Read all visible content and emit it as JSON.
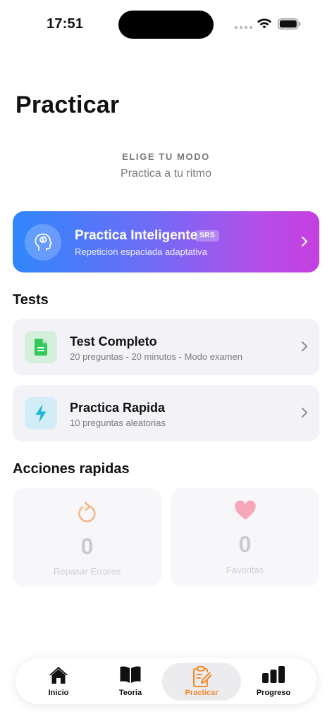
{
  "status_bar": {
    "time": "17:51"
  },
  "page": {
    "title": "Practicar",
    "mode_label": "ELIGE TU MODO",
    "mode_subtitle": "Practica a tu ritmo"
  },
  "smart_practice": {
    "title": "Practica Inteligente",
    "badge": "SRS",
    "subtitle": "Repeticion espaciada adaptativa",
    "icon": "brain-icon",
    "gradient": [
      "#2f86fb",
      "#c63fe0"
    ]
  },
  "tests": {
    "section_title": "Tests",
    "items": [
      {
        "title": "Test Completo",
        "subtitle": "20 preguntas - 20 minutos - Modo examen",
        "icon": "document-icon",
        "accent": "#34c759"
      },
      {
        "title": "Practica Rapida",
        "subtitle": "10 preguntas aleatorias",
        "icon": "bolt-icon",
        "accent": "#1fb8d6"
      }
    ]
  },
  "quick_actions": {
    "section_title": "Acciones rapidas",
    "items": [
      {
        "count": "0",
        "label": "Repasar Errores",
        "icon": "refresh-icon",
        "accent": "#f5b37f"
      },
      {
        "count": "0",
        "label": "Favoritas",
        "icon": "heart-icon",
        "accent": "#f7a3b4"
      }
    ]
  },
  "tab_bar": {
    "active_color": "#f08a2c",
    "tabs": [
      {
        "label": "Inicio",
        "icon": "home-icon"
      },
      {
        "label": "Teoria",
        "icon": "book-icon"
      },
      {
        "label": "Practicar",
        "icon": "clipboard-icon",
        "active": true
      },
      {
        "label": "Progreso",
        "icon": "bar-chart-icon"
      }
    ]
  }
}
